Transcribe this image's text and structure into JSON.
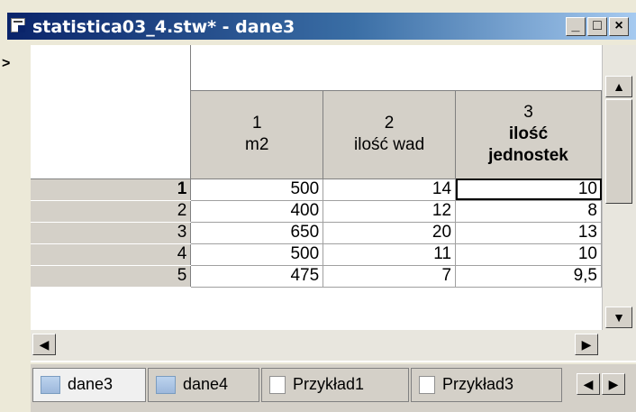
{
  "window": {
    "title": "statistica03_4.stw* - dane3",
    "minimize_glyph": "_",
    "maximize_glyph": "□",
    "close_glyph": "×",
    "row_marker": ">"
  },
  "columns": [
    {
      "number": "1",
      "name": "m2"
    },
    {
      "number": "2",
      "name": "ilość wad"
    },
    {
      "number": "3",
      "name": "ilość jednostek"
    }
  ],
  "rows": [
    {
      "id": "1",
      "values": [
        "500",
        "14",
        "10"
      ]
    },
    {
      "id": "2",
      "values": [
        "400",
        "12",
        "8"
      ]
    },
    {
      "id": "3",
      "values": [
        "650",
        "20",
        "13"
      ]
    },
    {
      "id": "4",
      "values": [
        "500",
        "11",
        "10"
      ]
    },
    {
      "id": "5",
      "values": [
        "475",
        "7",
        "9,5"
      ]
    }
  ],
  "tabs": [
    {
      "label": "dane3",
      "icon": "spreadsheet-icon"
    },
    {
      "label": "dane4",
      "icon": "spreadsheet-icon"
    },
    {
      "label": "Przykład1",
      "icon": "document-icon"
    },
    {
      "label": "Przykład3",
      "icon": "document-icon"
    }
  ],
  "scroll": {
    "up": "▲",
    "down": "▼",
    "left": "◀",
    "right": "▶"
  }
}
